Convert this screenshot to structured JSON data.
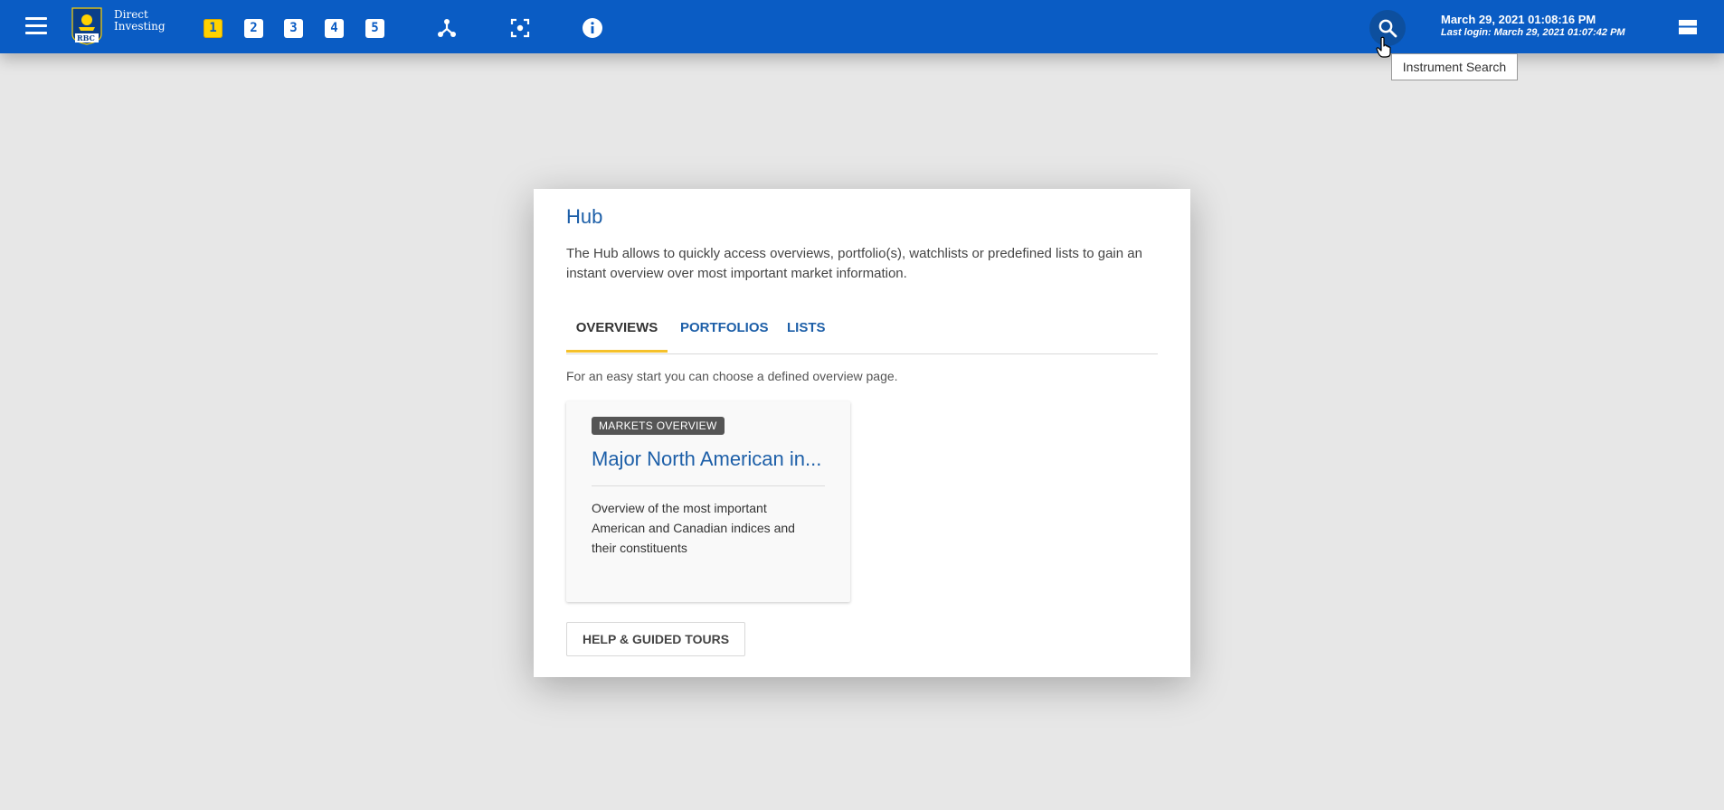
{
  "topbar": {
    "brand_line1": "Direct",
    "brand_line2": "Investing",
    "logo_text": "RBC",
    "workspaces": [
      "1",
      "2",
      "3",
      "4",
      "5"
    ],
    "active_workspace": "1",
    "datetime": "March 29, 2021 01:08:16 PM",
    "last_login": "Last login: March 29, 2021 01:07:42 PM",
    "tooltip": "Instrument Search",
    "accent_color": "#0a5cc4",
    "active_workspace_color": "#ffd200"
  },
  "hub": {
    "title": "Hub",
    "description": "The Hub allows to quickly access overviews, portfolio(s), watchlists or predefined lists to gain an instant overview over most important market information.",
    "tabs": [
      {
        "label": "OVERVIEWS",
        "active": true
      },
      {
        "label": "PORTFOLIOS",
        "active": false
      },
      {
        "label": "LISTS",
        "active": false
      }
    ],
    "hint": "For an easy start you can choose a defined overview page.",
    "overview_card": {
      "badge": "MARKETS OVERVIEW",
      "title": "Major North American in...",
      "description": "Overview of the most important American and Canadian indices and their constituents"
    },
    "help_button": "HELP & GUIDED TOURS"
  }
}
